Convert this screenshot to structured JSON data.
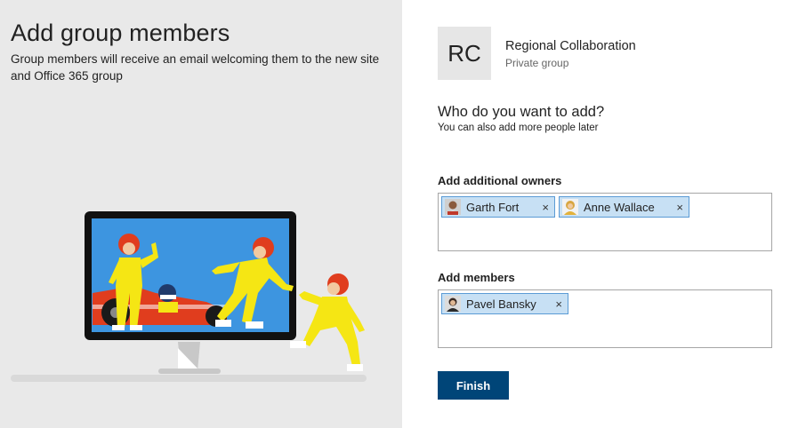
{
  "left": {
    "title": "Add group members",
    "subtitle": "Group members will receive an email welcoming them to the new site and Office 365 group"
  },
  "group": {
    "initials": "RC",
    "name": "Regional Collaboration",
    "type": "Private group"
  },
  "prompt": {
    "question": "Who do you want to add?",
    "hint": "You can also add more people later"
  },
  "owners": {
    "label": "Add additional owners",
    "people": [
      {
        "name": "Garth Fort",
        "remove_icon": "×"
      },
      {
        "name": "Anne Wallace",
        "remove_icon": "×"
      }
    ]
  },
  "members": {
    "label": "Add members",
    "people": [
      {
        "name": "Pavel Bansky",
        "remove_icon": "×"
      }
    ]
  },
  "finish_label": "Finish",
  "colors": {
    "left_panel": "#e9e9e9",
    "chip_fill": "#c7e0f4",
    "chip_border": "#5b9bd5",
    "button": "#004578",
    "screen": "#3d95e0",
    "figure_yellow": "#f5e614",
    "helmet_red": "#e03d1e"
  }
}
